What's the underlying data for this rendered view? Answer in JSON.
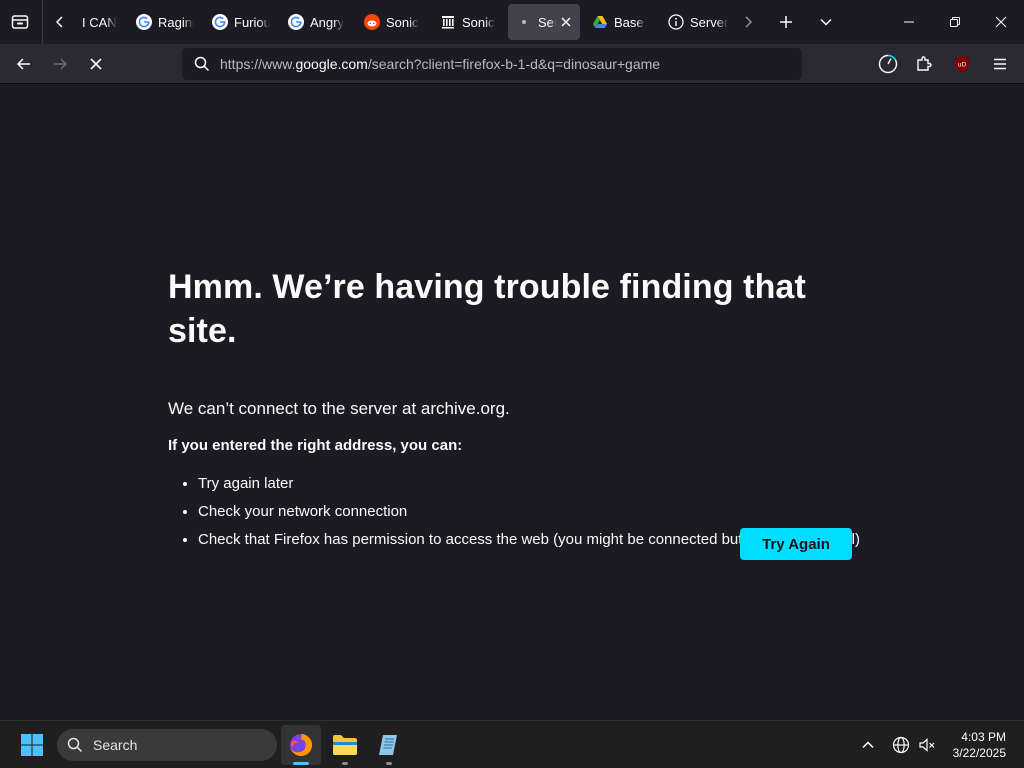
{
  "tabs": [
    {
      "title": "I CAN",
      "icon": "none"
    },
    {
      "title": "Raging",
      "icon": "google-icon"
    },
    {
      "title": "Furious",
      "icon": "google-icon"
    },
    {
      "title": "Angry",
      "icon": "google-icon"
    },
    {
      "title": "Sonic",
      "icon": "reddit-icon"
    },
    {
      "title": "Sonic",
      "icon": "museum-icon"
    },
    {
      "title": "Ser",
      "icon": "dot-icon",
      "active": true
    },
    {
      "title": "Base C",
      "icon": "google-drive-icon"
    },
    {
      "title": "Server",
      "icon": "info-icon"
    }
  ],
  "url": {
    "prefix": "https://www.",
    "host": "google.com",
    "suffix": "/search?client=firefox-b-1-d&q=dinosaur+game"
  },
  "error": {
    "title": "Hmm. We’re having trouble finding that site.",
    "description": "We can’t connect to the server at archive.org.",
    "subtitle": "If you entered the right address, you can:",
    "items": [
      "Try again later",
      "Check your network connection",
      "Check that Firefox has permission to access the web (you might be connected but behind a firewall)"
    ],
    "button": "Try Again"
  },
  "taskbar": {
    "search_label": "Search",
    "time": "4:03 PM",
    "date": "3/22/2025"
  },
  "colors": {
    "accent": "#00ddff",
    "background": "#1c1b22",
    "toolbar": "#2b2a33"
  }
}
